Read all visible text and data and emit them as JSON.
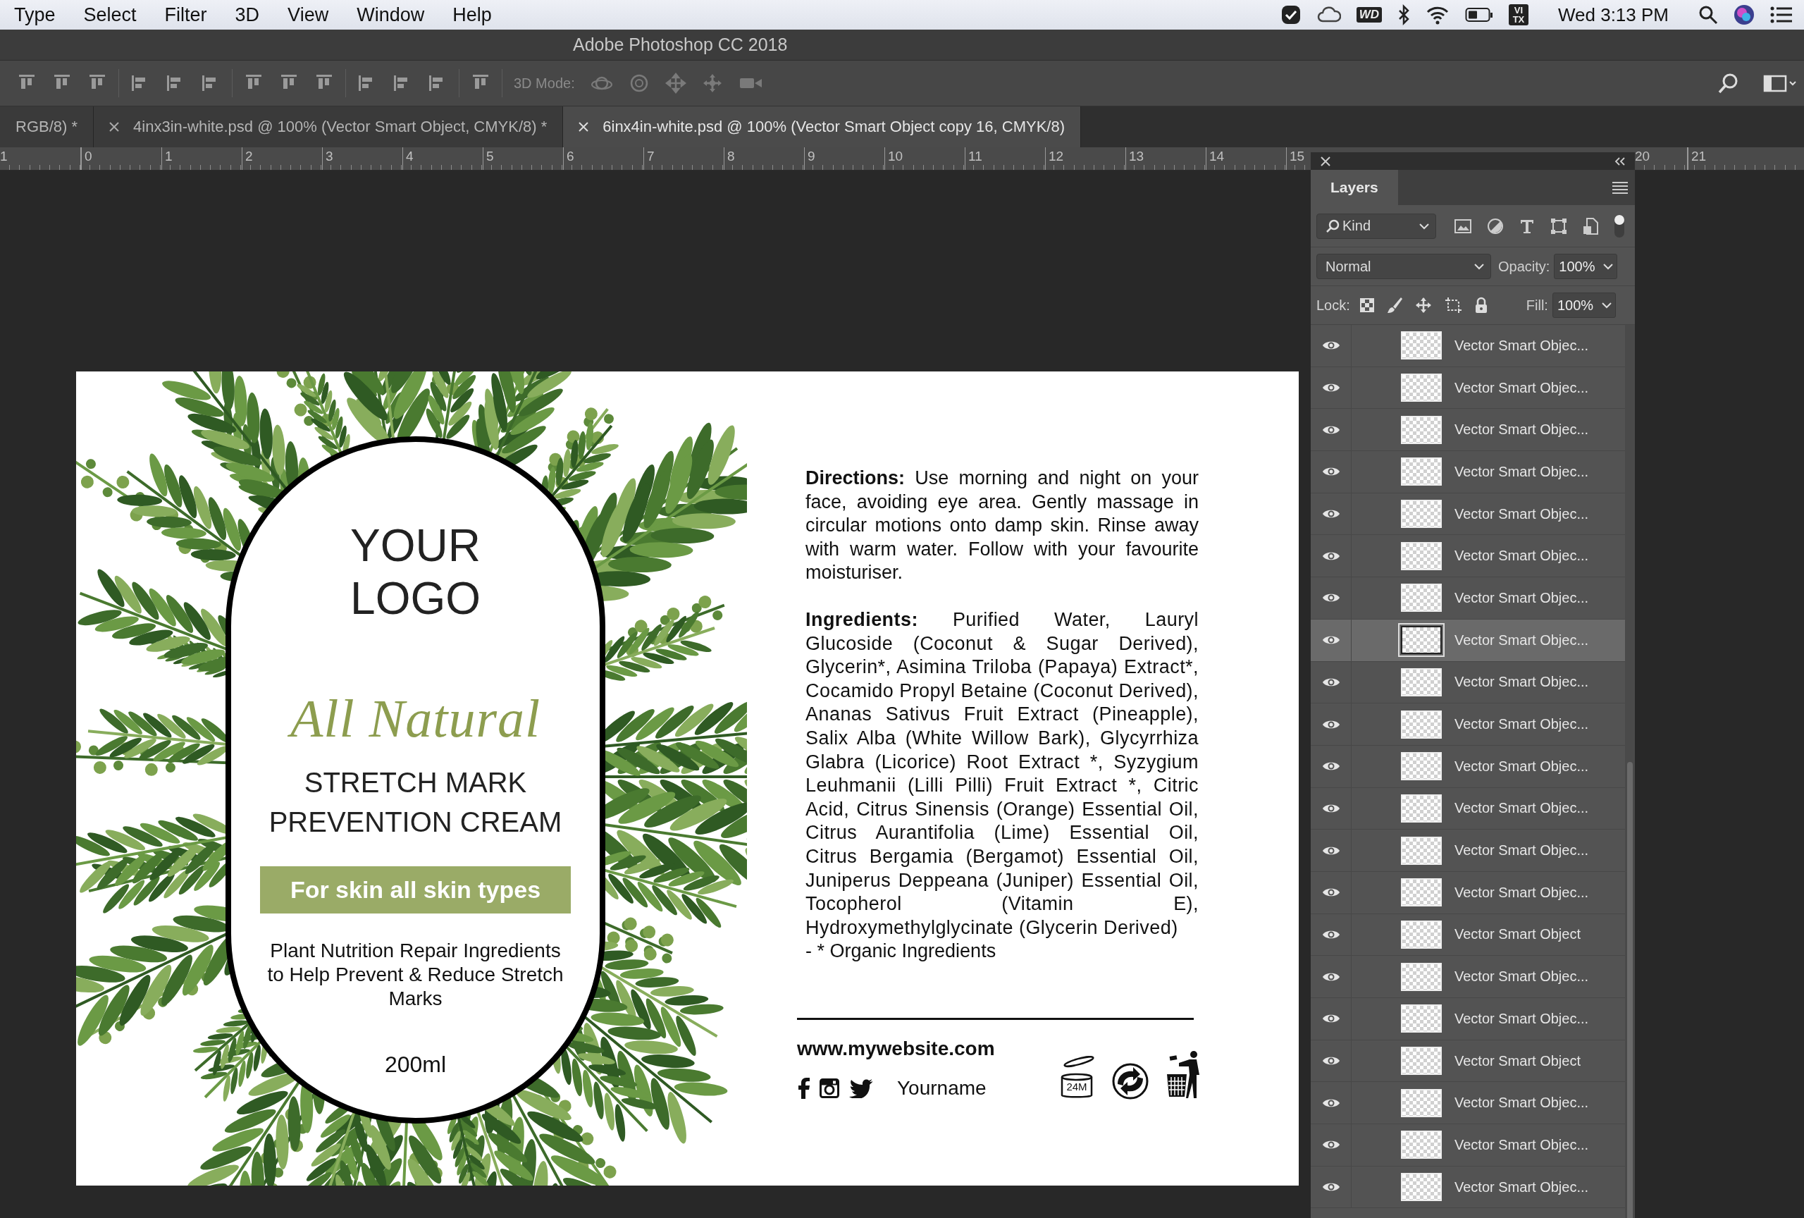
{
  "menu_bar": {
    "menus": [
      "Type",
      "Select",
      "Filter",
      "3D",
      "View",
      "Window",
      "Help"
    ],
    "status_badges": [
      "WD",
      "VI TX"
    ],
    "clock": "Wed 3:13 PM"
  },
  "app_title": "Adobe Photoshop CC 2018",
  "options_bar": {
    "mode_label": "3D Mode:"
  },
  "document_tabs": [
    {
      "title": "RGB/8) *",
      "closable": false,
      "selected": false
    },
    {
      "title": "4inx3in-white.psd @ 100% (Vector Smart Object, CMYK/8) *",
      "closable": true,
      "selected": false
    },
    {
      "title": "6inx4in-white.psd @ 100% (Vector Smart Object copy 16, CMYK/8)",
      "closable": true,
      "selected": true
    }
  ],
  "ruler": {
    "marks": [
      "1",
      "0",
      "1",
      "2",
      "3",
      "4",
      "5",
      "6",
      "7",
      "8",
      "9",
      "10",
      "11",
      "12",
      "13",
      "14",
      "15"
    ],
    "side_marks": [
      "20",
      "21"
    ]
  },
  "label": {
    "logo": "YOUR LOGO",
    "tagline": "All Natural",
    "product": "STRETCH MARK PREVENTION CREAM",
    "band": "For skin all skin types",
    "description": "Plant Nutrition Repair Ingredients to Help Prevent & Reduce Stretch Marks",
    "volume": "200ml",
    "directions": "**Directions:** Use morning and night on your face, avoiding eye area. Gently massage in circular motions onto damp skin. Rinse away with warm water. Follow with your favourite moisturiser.",
    "ingredients": "**Ingredients:** Purified Water, Lauryl Glucoside (Coconut & Sugar Derived), Glycerin*, Asimina Triloba (Papaya) Extract*, Cocamido Propyl Betaine (Coconut Derived), Ananas Sativus Fruit Extract (Pineapple), Salix Alba (White Willow Bark), Glycyrrhiza Glabra (Licorice) Root Extract *, Syzygium Leuhmanii (Lilli Pilli) Fruit Extract *, Citric Acid, Citrus Sinensis (Orange) Essential Oil, Citrus Aurantifolia (Lime) Essential Oil, Citrus Bergamia (Bergamot) Essential Oil, Juniperus Deppeana (Juniper) Essential Oil, Tocopherol (Vitamin E), Hydroxymethylglycinate (Glycerin Derived)",
    "footnote": "- * Organic Ingredients",
    "website": "www.mywebsite.com",
    "social_handle": "Yourname",
    "shelf_life": "24M"
  },
  "layers_panel": {
    "title": "Layers",
    "filter": "Kind",
    "blend_mode": "Normal",
    "opacity_label": "Opacity:",
    "opacity": "100%",
    "lock_label": "Lock:",
    "fill_label": "Fill:",
    "fill": "100%",
    "layers": [
      {
        "name": "Vector Smart Objec...",
        "visible": true,
        "selected": false
      },
      {
        "name": "Vector Smart Objec...",
        "visible": true,
        "selected": false
      },
      {
        "name": "Vector Smart Objec...",
        "visible": true,
        "selected": false
      },
      {
        "name": "Vector Smart Objec...",
        "visible": true,
        "selected": false
      },
      {
        "name": "Vector Smart Objec...",
        "visible": true,
        "selected": false
      },
      {
        "name": "Vector Smart Objec...",
        "visible": true,
        "selected": false
      },
      {
        "name": "Vector Smart Objec...",
        "visible": true,
        "selected": false
      },
      {
        "name": "Vector Smart Objec...",
        "visible": true,
        "selected": true
      },
      {
        "name": "Vector Smart Objec...",
        "visible": true,
        "selected": false
      },
      {
        "name": "Vector Smart Objec...",
        "visible": true,
        "selected": false
      },
      {
        "name": "Vector Smart Objec...",
        "visible": true,
        "selected": false
      },
      {
        "name": "Vector Smart Objec...",
        "visible": true,
        "selected": false
      },
      {
        "name": "Vector Smart Objec...",
        "visible": true,
        "selected": false
      },
      {
        "name": "Vector Smart Objec...",
        "visible": true,
        "selected": false
      },
      {
        "name": "Vector Smart Object",
        "visible": true,
        "selected": false
      },
      {
        "name": "Vector Smart Objec...",
        "visible": true,
        "selected": false
      },
      {
        "name": "Vector Smart Objec...",
        "visible": true,
        "selected": false
      },
      {
        "name": "Vector Smart Object",
        "visible": true,
        "selected": false
      },
      {
        "name": "Vector Smart Objec...",
        "visible": true,
        "selected": false
      },
      {
        "name": "Vector Smart Objec...",
        "visible": true,
        "selected": false
      },
      {
        "name": "Vector Smart Objec...",
        "visible": true,
        "selected": false
      }
    ]
  }
}
